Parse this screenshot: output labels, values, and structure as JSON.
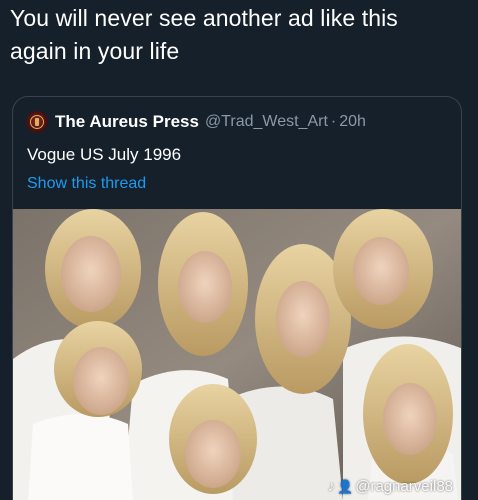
{
  "caption": {
    "line1": "You will never see another ad like this",
    "line2": "again in your life"
  },
  "quoted_tweet": {
    "display_name": "The Aureus Press",
    "handle": "@Trad_West_Art",
    "separator": "·",
    "age": "20h",
    "text": "Vogue US July 1996",
    "show_thread": "Show this thread",
    "avatar_icon": "crest-logo-icon"
  },
  "photo": {
    "description_icon": "group-portrait-photo",
    "watermark": {
      "app_icon": "tiktok-icon",
      "user_icon": "user-icon",
      "username": "@ragnarveil88"
    }
  },
  "colors": {
    "background": "#15202b",
    "link": "#1d9bf0",
    "secondary_text": "#8b98a5",
    "border": "#38444d"
  }
}
